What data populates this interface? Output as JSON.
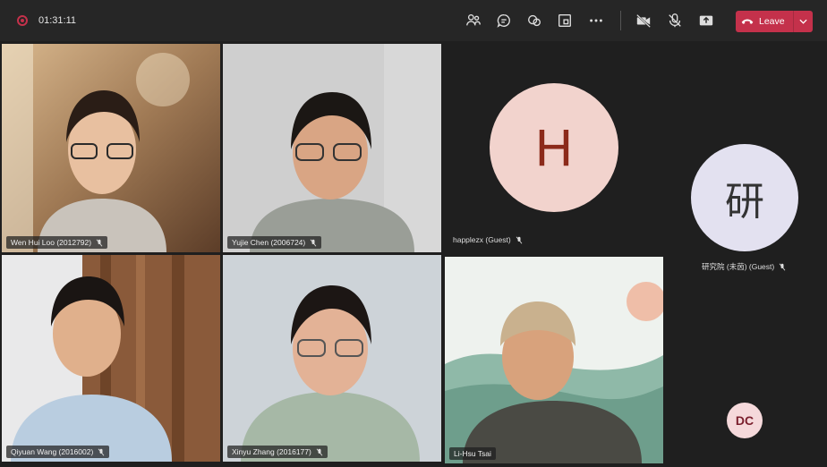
{
  "meeting": {
    "elapsed": "01:31:11"
  },
  "toolbar": {
    "leave_label": "Leave",
    "icons": [
      "people-icon",
      "chat-icon",
      "reactions-icon",
      "share-tray-icon",
      "more-icon",
      "camera-off-icon",
      "mic-off-icon",
      "share-icon"
    ]
  },
  "participants": [
    {
      "name": "Wen Hui Loo (2012792)",
      "muted": true
    },
    {
      "name": "Yujie Chen (2006724)",
      "muted": true
    },
    {
      "name": "Qiyuan Wang (2016002)",
      "muted": true
    },
    {
      "name": "Xinyu Zhang (2016177)",
      "muted": true
    },
    {
      "name": "Li-Hsu Tsai",
      "muted": false,
      "speaking": true
    }
  ],
  "avatars": [
    {
      "initial": "H",
      "name": "happlezx (Guest)",
      "bg": "#f2d3cd",
      "fg": "#8c2a1a",
      "muted": true
    },
    {
      "initial": "研",
      "name": "研究院 (未茵) (Guest)",
      "bg": "#e3e1f0",
      "fg": "#333",
      "muted": true
    },
    {
      "initial": "DC",
      "name": "",
      "bg": "#f5d9db",
      "fg": "#7a1f2d"
    }
  ],
  "colors": {
    "accent_leave": "#c4314b",
    "active_speaker_border": "#8b8fd6"
  }
}
